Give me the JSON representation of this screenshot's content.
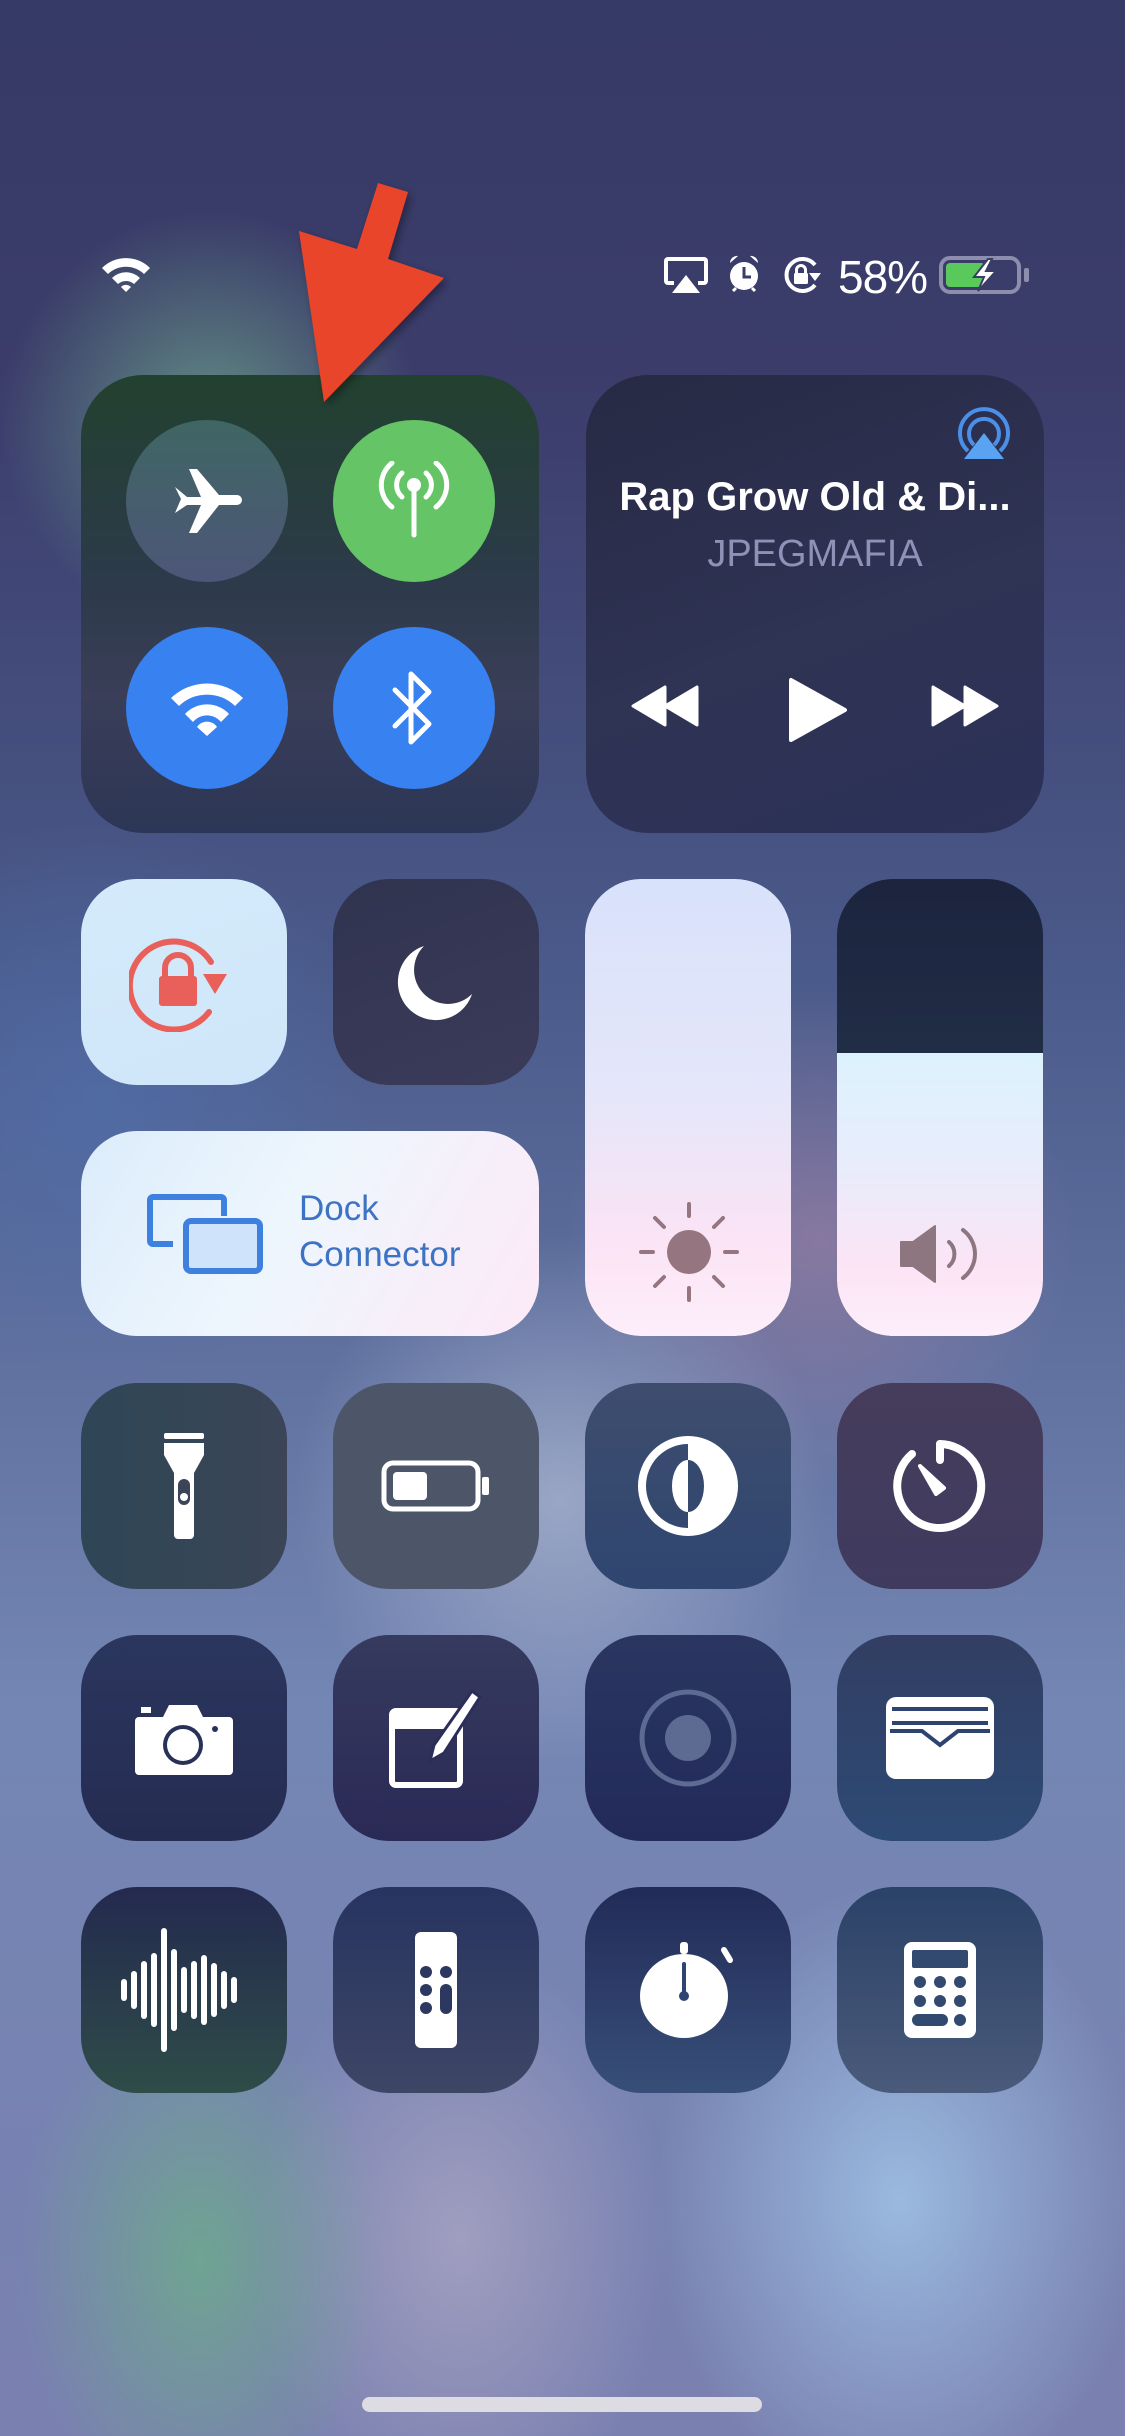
{
  "status_bar": {
    "wifi_icon": "wifi-icon",
    "indicators": [
      "airplay-icon",
      "alarm-icon",
      "rotation-lock-icon"
    ],
    "battery_percent_label": "58%",
    "battery_level": 0.58,
    "battery_charging": true
  },
  "annotation": {
    "type": "red-arrow",
    "color": "#e8442a",
    "points_to": "cellular-data-toggle"
  },
  "connectivity": {
    "airplane_mode": {
      "icon": "airplane-icon",
      "on": false
    },
    "cellular_data": {
      "icon": "antenna-icon",
      "on": true,
      "color": "#64c466"
    },
    "wifi": {
      "icon": "wifi-icon",
      "on": true,
      "color": "#3781f0"
    },
    "bluetooth": {
      "icon": "bluetooth-icon",
      "on": true,
      "color": "#3781f0"
    }
  },
  "now_playing": {
    "title": "Rap Grow Old & Di...",
    "artist": "JPEGMAFIA",
    "airplay_icon": "airplay-audio-icon",
    "controls": [
      "rewind-icon",
      "play-icon",
      "fast-forward-icon"
    ]
  },
  "toggles": {
    "rotation_lock": {
      "icon": "rotation-lock-icon",
      "on": true,
      "color": "#e9605a"
    },
    "do_not_disturb": {
      "icon": "moon-icon",
      "on": false
    }
  },
  "screen_mirroring": {
    "line1": "Dock",
    "line2": "Connector",
    "icon": "screen-mirroring-icon",
    "color": "#3d73c3"
  },
  "sliders": {
    "brightness": {
      "icon": "sun-icon",
      "level": 1.0
    },
    "volume": {
      "icon": "speaker-icon",
      "level": 0.62
    }
  },
  "shortcuts": [
    {
      "name": "flashlight",
      "icon": "flashlight-icon"
    },
    {
      "name": "low-power-mode",
      "icon": "battery-icon"
    },
    {
      "name": "dark-mode",
      "icon": "dark-mode-icon"
    },
    {
      "name": "timer",
      "icon": "timer-icon"
    },
    {
      "name": "camera",
      "icon": "camera-icon"
    },
    {
      "name": "notes",
      "icon": "notes-icon"
    },
    {
      "name": "screen-recording",
      "icon": "record-icon"
    },
    {
      "name": "wallet",
      "icon": "wallet-icon"
    },
    {
      "name": "voice-memos",
      "icon": "waveform-icon"
    },
    {
      "name": "apple-tv-remote",
      "icon": "remote-icon"
    },
    {
      "name": "stopwatch",
      "icon": "stopwatch-icon"
    },
    {
      "name": "calculator",
      "icon": "calculator-icon"
    }
  ]
}
